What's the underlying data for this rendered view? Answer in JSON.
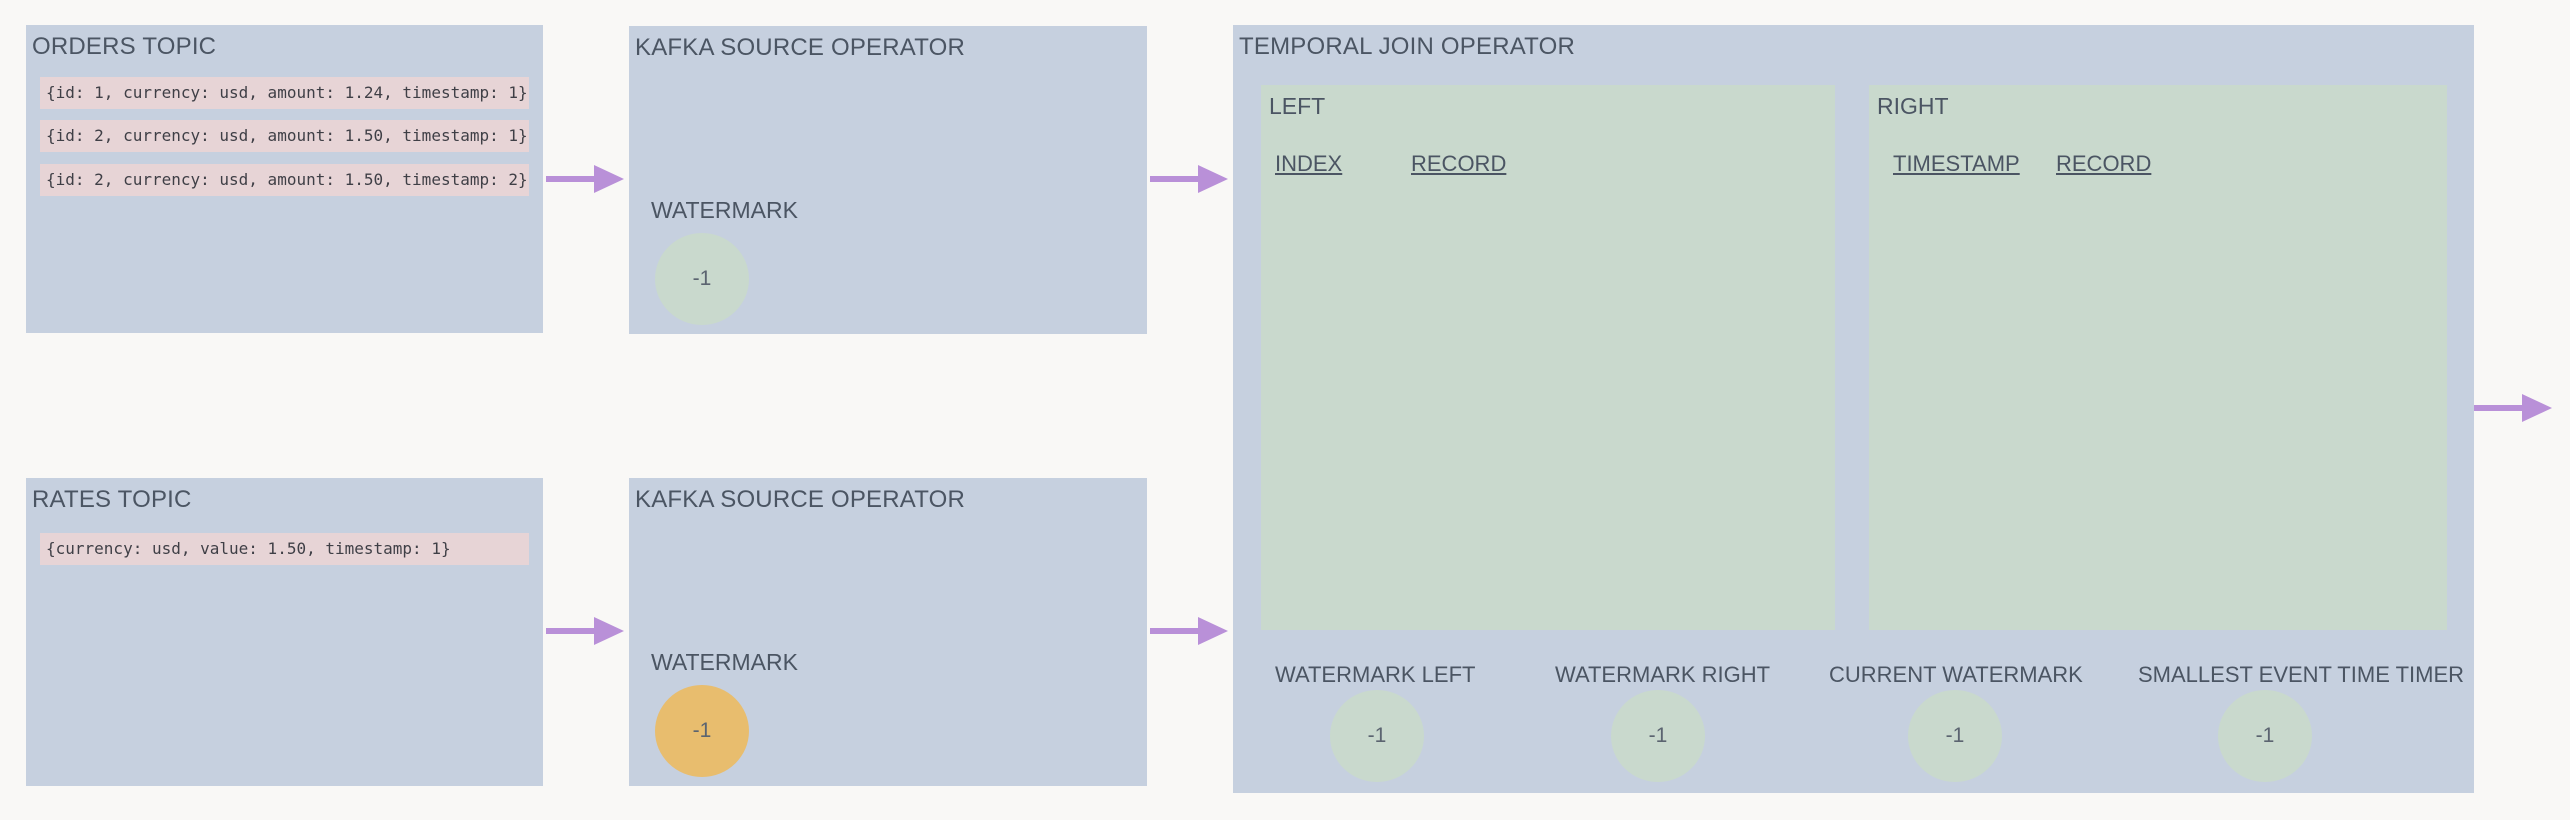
{
  "orders_topic": {
    "title": "ORDERS TOPIC",
    "records": [
      "{id: 1, currency: usd, amount: 1.24, timestamp: 1}",
      "{id: 2, currency: usd, amount: 1.50, timestamp: 1}",
      "{id: 2, currency: usd, amount: 1.50, timestamp: 2}"
    ]
  },
  "rates_topic": {
    "title": "RATES TOPIC",
    "records": [
      "{currency: usd, value: 1.50, timestamp: 1}"
    ]
  },
  "source_orders": {
    "title": "KAFKA SOURCE OPERATOR",
    "watermark_label": "WATERMARK",
    "watermark_value": "-1",
    "watermark_color": "#c9d9cd"
  },
  "source_rates": {
    "title": "KAFKA SOURCE OPERATOR",
    "watermark_label": "WATERMARK",
    "watermark_value": "-1",
    "watermark_color": "#e8bd6e"
  },
  "join": {
    "title": "TEMPORAL JOIN OPERATOR",
    "left": {
      "title": "LEFT",
      "columns": [
        "INDEX",
        "RECORD"
      ]
    },
    "right": {
      "title": "RIGHT",
      "columns": [
        "TIMESTAMP",
        "RECORD"
      ]
    },
    "metrics": [
      {
        "label": "WATERMARK LEFT",
        "value": "-1"
      },
      {
        "label": "WATERMARK RIGHT",
        "value": "-1"
      },
      {
        "label": "CURRENT WATERMARK",
        "value": "-1"
      },
      {
        "label": "SMALLEST EVENT TIME TIMER",
        "value": "-1"
      }
    ]
  },
  "colors": {
    "background": "#f9f8f6",
    "box": "#c6d0df",
    "panel": "#c9d9cd",
    "record": "#e7d4d6",
    "arrow": "#b990d8"
  }
}
